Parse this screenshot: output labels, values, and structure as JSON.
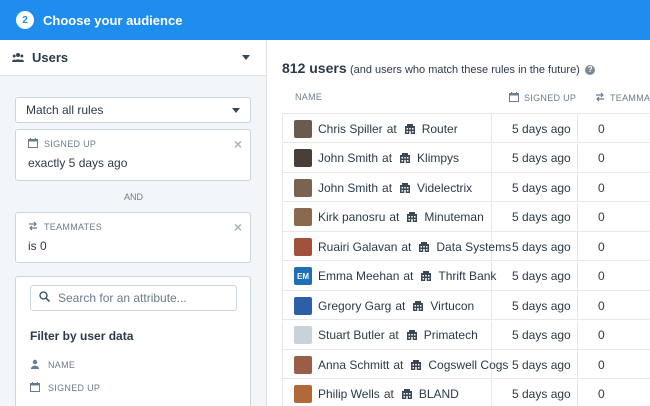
{
  "header": {
    "step": "2",
    "title": "Choose your audience"
  },
  "sidebar": {
    "segment_label": "Users",
    "match_select": "Match all rules",
    "rules": [
      {
        "label": "SIGNED UP",
        "value": "exactly 5 days ago",
        "icon": "calendar-icon"
      },
      {
        "label": "TEAMMATES",
        "value": "is 0",
        "icon": "swap-arrows-icon"
      }
    ],
    "connector": "AND",
    "filter": {
      "search_placeholder": "Search for an attribute...",
      "title": "Filter by user data",
      "items": [
        {
          "label": "NAME",
          "icon": "person-icon"
        },
        {
          "label": "SIGNED UP",
          "icon": "calendar-icon"
        }
      ]
    }
  },
  "results": {
    "count": "812 users",
    "subtitle": "(and users who match these rules in the future)",
    "columns": {
      "name": "NAME",
      "signed_up": "SIGNED UP",
      "teammates": "TEAMMAT"
    },
    "at_word": "at",
    "rows": [
      {
        "name": "Chris Spiller",
        "company": "Router",
        "signed_up": "5 days ago",
        "teammates": "0",
        "avatar": "#6b5a4e"
      },
      {
        "name": "John Smith",
        "company": "Klimpys",
        "signed_up": "5 days ago",
        "teammates": "0",
        "avatar": "#4a3f38"
      },
      {
        "name": "John Smith",
        "company": "Videlectrix",
        "signed_up": "5 days ago",
        "teammates": "0",
        "avatar": "#7a6352"
      },
      {
        "name": "Kirk panosru",
        "company": "Minuteman",
        "signed_up": "5 days ago",
        "teammates": "0",
        "avatar": "#8a6a4f"
      },
      {
        "name": "Ruairi Galavan",
        "company": "Data Systems",
        "signed_up": "5 days ago",
        "teammates": "0",
        "avatar": "#a0523a"
      },
      {
        "name": "Emma Meehan",
        "company": "Thrift Bank",
        "signed_up": "5 days ago",
        "teammates": "0",
        "avatar": "#1f6fb5",
        "initials": "EM"
      },
      {
        "name": "Gregory Garg",
        "company": "Virtucon",
        "signed_up": "5 days ago",
        "teammates": "0",
        "avatar": "#2d5fa8"
      },
      {
        "name": "Stuart Butler",
        "company": "Primatech",
        "signed_up": "5 days ago",
        "teammates": "0",
        "avatar": "#c9d2da"
      },
      {
        "name": "Anna Schmitt",
        "company": "Cogswell Cogs",
        "signed_up": "5 days ago",
        "teammates": "0",
        "avatar": "#9a5d48"
      },
      {
        "name": "Philip Wells",
        "company": "BLAND",
        "signed_up": "5 days ago",
        "teammates": "0",
        "avatar": "#b06a3a"
      }
    ]
  },
  "colors": {
    "accent": "#1f8ded",
    "sidebar_bg": "#f3f6f8",
    "border": "#cdd5dc"
  }
}
